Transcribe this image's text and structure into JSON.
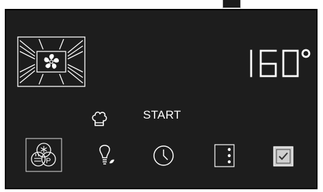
{
  "display": {
    "temperature": "160",
    "degree_symbol": "°"
  },
  "controls": {
    "start_label": "START"
  },
  "icons": {
    "oven_mode": "fan-mode-icon",
    "chef": "chef-hat-icon",
    "combi": "steam-combi-icon",
    "light": "lightbulb-icon",
    "timer": "clock-icon",
    "menu": "more-vertical-icon",
    "confirm": "checkbox-icon"
  },
  "colors": {
    "panel_bg": "#1d1d1d",
    "foreground": "#ffffff",
    "checkbox_fill": "#d0d0d0"
  }
}
